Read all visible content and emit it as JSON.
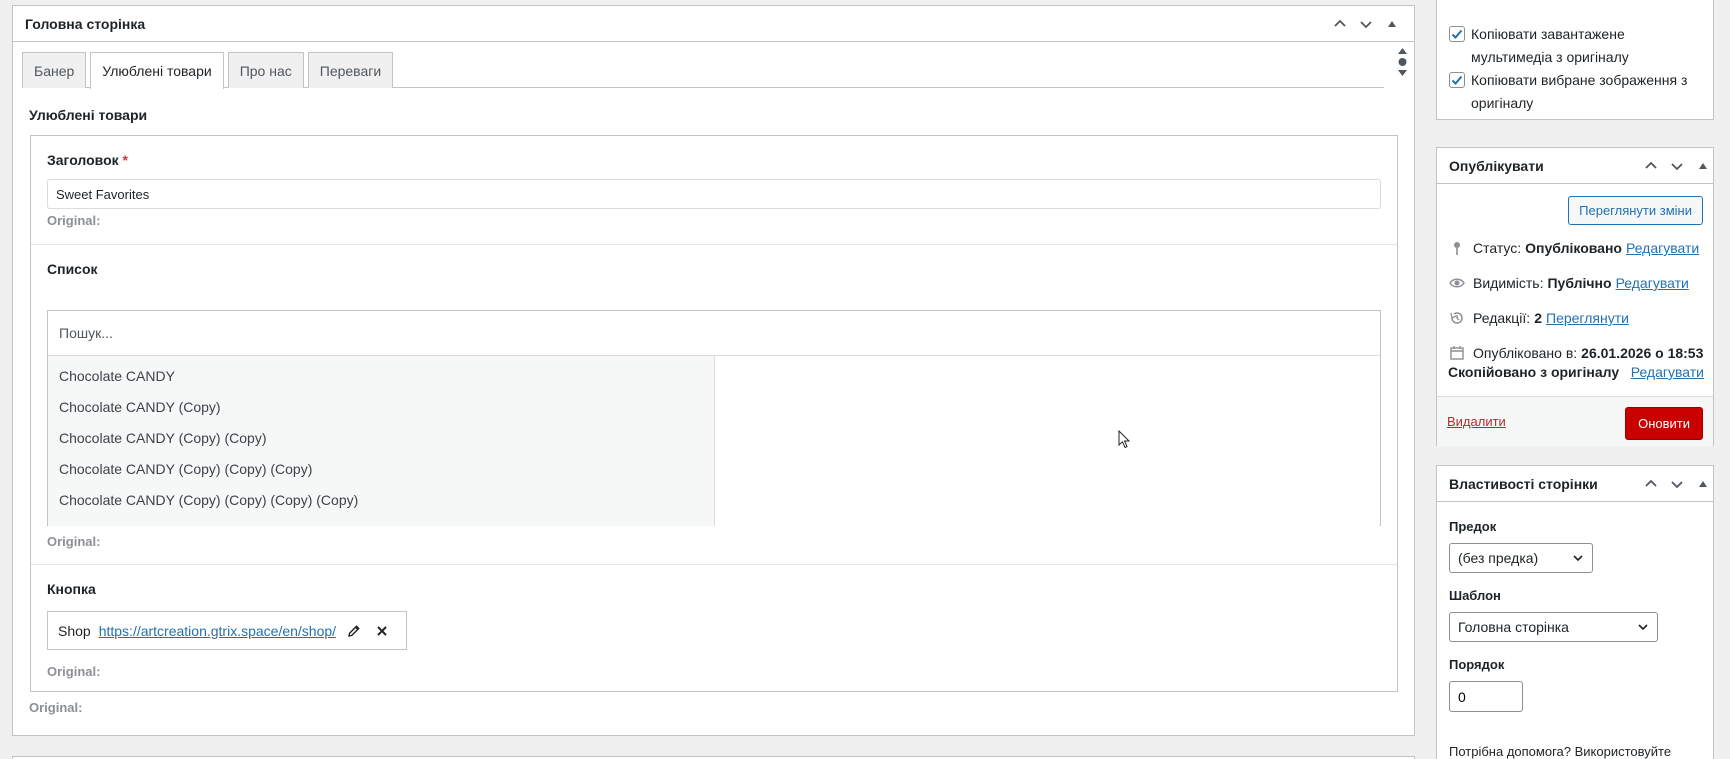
{
  "metabox": {
    "title": "Головна сторінка",
    "tabs": [
      "Банер",
      "Улюблені товари",
      "Про нас",
      "Переваги"
    ],
    "active_tab_index": 1,
    "section_title": "Улюблені товари",
    "title_field": {
      "label": "Заголовок",
      "required_mark": "*",
      "value": "Sweet Favorites",
      "original": "Original:"
    },
    "list_field": {
      "label": "Список",
      "search_placeholder": "Пошук...",
      "items": [
        "Chocolate CANDY",
        "Chocolate CANDY (Copy)",
        "Chocolate CANDY (Copy) (Copy)",
        "Chocolate CANDY (Copy) (Copy) (Copy)",
        "Chocolate CANDY (Copy) (Copy) (Copy) (Copy)"
      ],
      "original": "Original:"
    },
    "button_field": {
      "label": "Кнопка",
      "link_title": "Shop",
      "link_url": "https://artcreation.gtrix.space/en/shop/",
      "original": "Original:"
    },
    "outer_original": "Original:"
  },
  "sidebar": {
    "copy_options": [
      {
        "label": "Копіювати завантажене мультимедіа з оригіналу",
        "checked": true
      },
      {
        "label": "Копіювати вибране зображення з оригіналу",
        "checked": true
      }
    ],
    "publish": {
      "title": "Опублікувати",
      "preview_button": "Переглянути зміни",
      "status_label": "Статус:",
      "status_value": "Опубліковано",
      "status_edit": "Редагувати",
      "visibility_label": "Видимість:",
      "visibility_value": "Публічно",
      "visibility_edit": "Редагувати",
      "revisions_label": "Редакції:",
      "revisions_value": "2",
      "revisions_link": "Переглянути",
      "published_label": "Опубліковано в:",
      "published_value": "26.01.2026 о 18:53",
      "copied_label": "Скопійовано з оригіналу",
      "copied_edit": "Редагувати",
      "delete_link": "Видалити",
      "update_button": "Оновити"
    },
    "page_attributes": {
      "title": "Властивості сторінки",
      "parent_label": "Предок",
      "parent_value": "(без предка)",
      "template_label": "Шаблон",
      "template_value": "Головна сторінка",
      "order_label": "Порядок",
      "order_value": "0",
      "help_text": "Потрібна допомога? Використовуйте вкладку «Допомога» над заголовком"
    }
  },
  "colors": {
    "accent": "#2271b1",
    "primary_button": "#c80000",
    "delete_link": "#b32d2e",
    "border": "#c3c4c7",
    "background": "#f0f0f1"
  }
}
